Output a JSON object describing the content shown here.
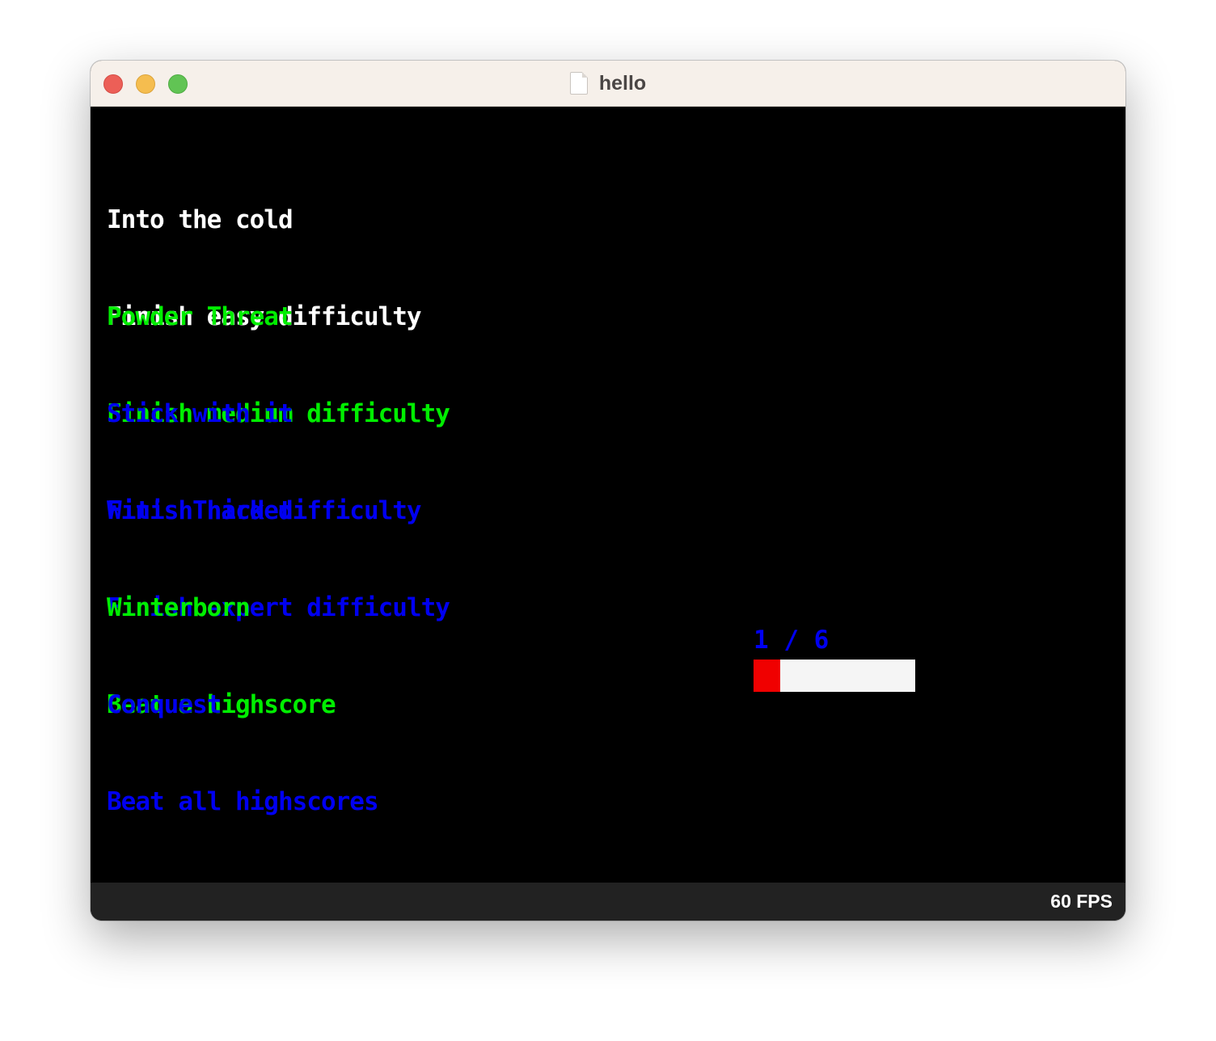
{
  "window": {
    "title": "hello",
    "file_icon": "document-icon"
  },
  "colors": {
    "white": "#ffffff",
    "green": "#00ee00",
    "blue": "#0000f0",
    "progress_fill": "#f00000",
    "progress_track": "#f5f5f5",
    "background": "#000000",
    "statusbar": "#222222"
  },
  "achievements": [
    {
      "name": "Into the cold",
      "description": "Finish easy difficulty",
      "color": "#ffffff"
    },
    {
      "name": "Powder Threat",
      "description": "Finish medium difficulty",
      "color": "#00ee00"
    },
    {
      "name": "Stick with it",
      "description": "Finish hard difficulty",
      "color": "#0000f0"
    },
    {
      "name": "Wit's Thicket",
      "description": "Finish expert difficulty",
      "color": "#0000f0"
    },
    {
      "name": "Winterborn",
      "description": "Beat a highscore",
      "color": "#00ee00"
    },
    {
      "name": "Conquest",
      "description": "Beat all highscores",
      "color": "#0000f0"
    }
  ],
  "conquest_progress": {
    "label": "1 / 6",
    "current": 1,
    "total": 6
  },
  "status": {
    "fps_label": "60 FPS"
  }
}
